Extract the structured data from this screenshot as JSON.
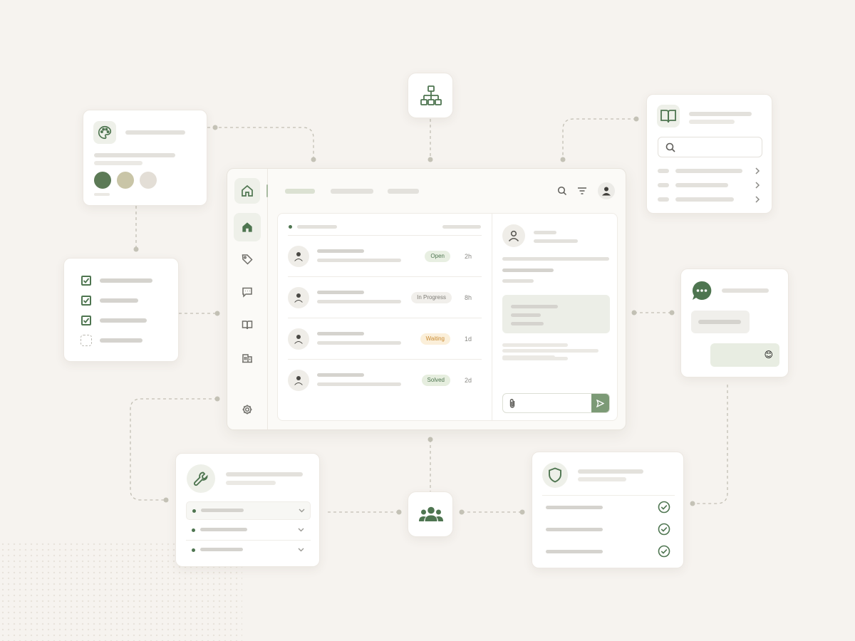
{
  "tickets": [
    {
      "status": "Open",
      "time": "2h",
      "badge_bg": "#e8efe2",
      "badge_fg": "#4e7550"
    },
    {
      "status": "In Progress",
      "time": "8h",
      "badge_bg": "#f1efeb",
      "badge_fg": "#7d7b75"
    },
    {
      "status": "Waiting",
      "time": "1d",
      "badge_bg": "#fbefd9",
      "badge_fg": "#c98b34"
    },
    {
      "status": "Solved",
      "time": "2d",
      "badge_bg": "#e6eedf",
      "badge_fg": "#4e7550"
    }
  ],
  "chat": {
    "emoji": "😊"
  },
  "palette": {
    "swatches": [
      "#5c7a56",
      "#c9c5a7",
      "#e3ded6"
    ]
  },
  "colors": {
    "accent": "#4e7550",
    "background": "#f6f3ef"
  },
  "icons": {
    "org_chart": "org-chart-icon",
    "palette": "palette-icon",
    "book": "book-icon",
    "chat": "chat-bubble-icon",
    "wrench": "wrench-icon",
    "shield": "shield-icon",
    "team": "team-icon"
  }
}
